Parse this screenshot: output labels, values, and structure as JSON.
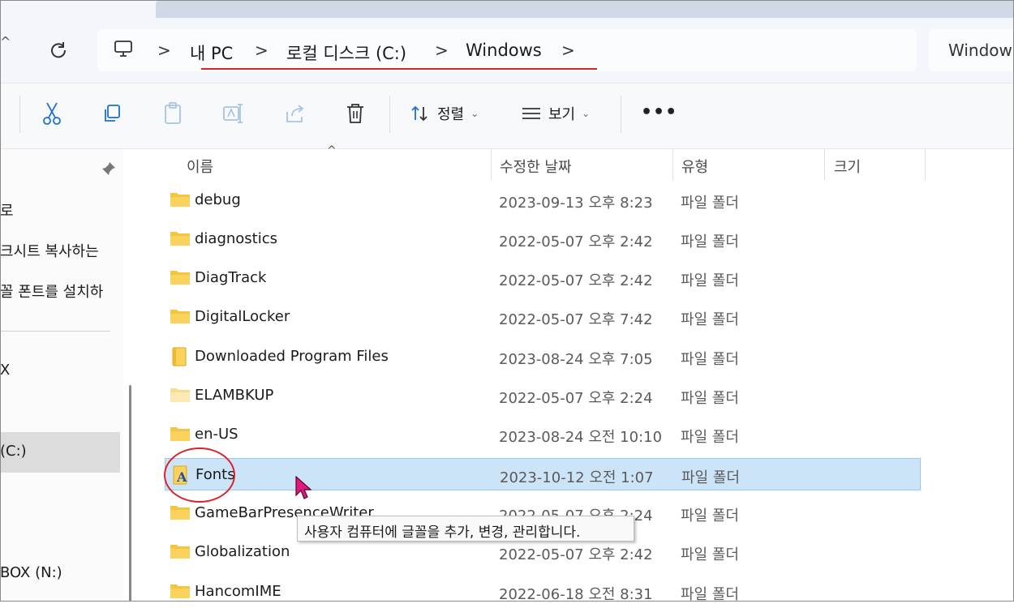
{
  "breadcrumb": {
    "items": [
      "내 PC",
      "로컬 디스크 (C:)",
      "Windows"
    ],
    "separator": ">"
  },
  "search": {
    "text": "Window"
  },
  "toolbar": {
    "sort_label": "정렬",
    "view_label": "보기",
    "more_label": "•••"
  },
  "nav": {
    "items": [
      "로",
      "크시트 복사하는",
      "꼴 폰트를 설치하",
      "X",
      "(C:)",
      "BOX (N:)"
    ]
  },
  "columns": {
    "name": "이름",
    "date": "수정한 날짜",
    "type": "유형",
    "size": "크기"
  },
  "files": [
    {
      "name": "debug",
      "date": "2023-09-13 오후 8:23",
      "type": "파일 폴더"
    },
    {
      "name": "diagnostics",
      "date": "2022-05-07 오후 2:42",
      "type": "파일 폴더"
    },
    {
      "name": "DiagTrack",
      "date": "2022-05-07 오후 2:42",
      "type": "파일 폴더"
    },
    {
      "name": "DigitalLocker",
      "date": "2022-05-07 오후 7:42",
      "type": "파일 폴더"
    },
    {
      "name": "Downloaded Program Files",
      "date": "2023-08-24 오후 7:05",
      "type": "파일 폴더"
    },
    {
      "name": "ELAMBKUP",
      "date": "2022-05-07 오후 2:24",
      "type": "파일 폴더"
    },
    {
      "name": "en-US",
      "date": "2023-08-24 오전 10:10",
      "type": "파일 폴더"
    },
    {
      "name": "Fonts",
      "date": "2023-10-12 오전 1:07",
      "type": "파일 폴더"
    },
    {
      "name": "GameBarPresenceWriter",
      "date": "2022-05-07 오후 2:24",
      "type": "파일 폴더"
    },
    {
      "name": "Globalization",
      "date": "2022-05-07 오후 2:42",
      "type": "파일 폴더"
    },
    {
      "name": "HancomIME",
      "date": "2022-06-18 오전 8:31",
      "type": "파일 폴더"
    }
  ],
  "tooltip": {
    "text": "사용자 컴퓨터에 글꼴을 추가, 변경, 관리합니다."
  },
  "colors": {
    "selection": "#cce4f7",
    "annotation_red": "#d9252a",
    "folder": "#f5c542",
    "cursor": "#e0197d"
  }
}
